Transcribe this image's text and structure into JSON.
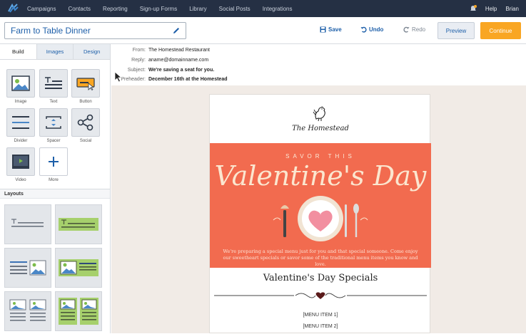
{
  "nav": {
    "items": [
      "Campaigns",
      "Contacts",
      "Reporting",
      "Sign-up Forms",
      "Library",
      "Social Posts",
      "Integrations"
    ],
    "help": "Help",
    "user": "Brian"
  },
  "toolbar": {
    "title": "Farm to Table Dinner",
    "save": "Save",
    "undo": "Undo",
    "redo": "Redo",
    "preview": "Preview",
    "continue": "Continue"
  },
  "left": {
    "tabs": [
      "Build",
      "Images",
      "Design"
    ],
    "blocks": [
      "Image",
      "Text",
      "Button",
      "Divider",
      "Spacer",
      "Social",
      "Video",
      "More"
    ],
    "layouts_title": "Layouts"
  },
  "headers": {
    "from_label": "From:",
    "from": "The Homestead Restaurant",
    "reply_label": "Reply:",
    "reply": "aname@domainname.com",
    "subject_label": "Subject:",
    "subject": "We're saving a seat for you.",
    "preheader_label": "Preheader:",
    "preheader": "December 16th at the Homestead"
  },
  "email": {
    "brand": "The Homestead",
    "savor": "SAVOR THIS",
    "headline": "Valentine's Day",
    "blurb": "We're preparing a special menu just for you and that special someone. Come enjoy our sweetheart specials or savor some of the traditional menu items you know and love.",
    "specials_title": "Valentine's Day Specials",
    "menu_items": [
      "[MENU ITEM 1]",
      "[MENU ITEM 2]"
    ]
  },
  "colors": {
    "nav_bg": "#253044",
    "accent_blue": "#1d5fa9",
    "continue_orange": "#f9a623",
    "hero_bg": "#f26b4f"
  }
}
